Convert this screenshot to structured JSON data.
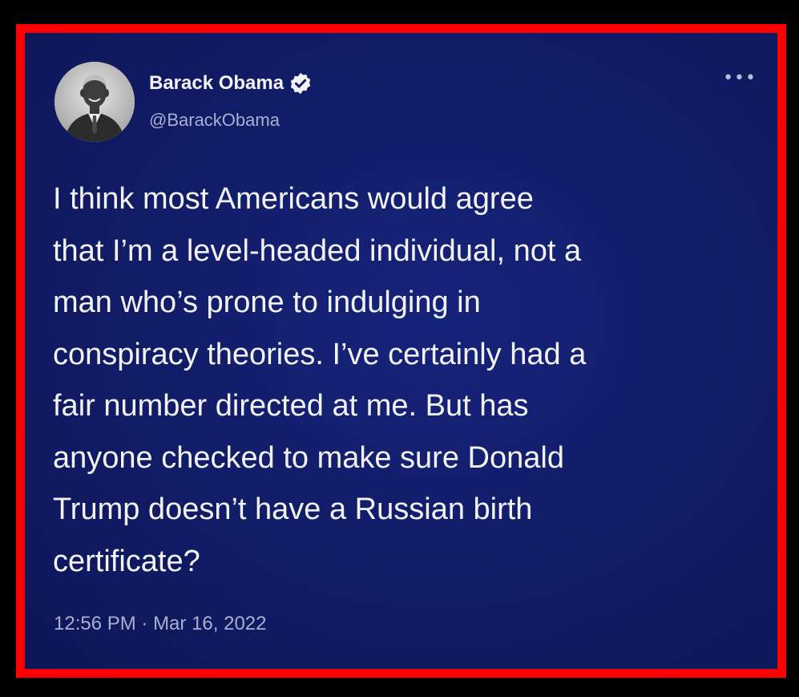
{
  "author": {
    "name": "Barack Obama",
    "handle": "@BarackObama"
  },
  "tweet": {
    "lines": [
      "I think most Americans would agree",
      "that I’m a level-headed individual, not a",
      "man who’s prone to indulging in",
      "conspiracy theories. I’ve certainly had a",
      "fair number directed at me. But has",
      "anyone checked to make sure Donald",
      "Trump doesn’t have a Russian birth",
      "certificate?"
    ]
  },
  "meta": {
    "time": "12:56 PM",
    "separator": " · ",
    "date": "Mar 16, 2022"
  },
  "icons": {
    "more": "more-options-icon",
    "verified": "verified-badge-icon"
  },
  "colors": {
    "frame": "#ff0000",
    "card_background": "#111c66",
    "text": "#f2f2f2",
    "secondary_text": "#a9b0cf"
  }
}
